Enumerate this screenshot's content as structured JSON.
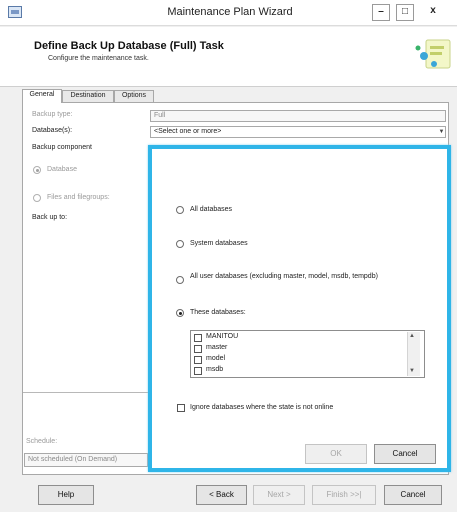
{
  "window": {
    "title": "Maintenance Plan Wizard",
    "minimize": "–",
    "maximize": "□",
    "close": "x"
  },
  "header": {
    "title": "Define Back Up Database (Full) Task",
    "subtitle": "Configure the maintenance task."
  },
  "tabs": [
    {
      "label": "General",
      "active": true
    },
    {
      "label": "Destination",
      "active": false
    },
    {
      "label": "Options",
      "active": false
    }
  ],
  "general": {
    "backup_type_label": "Backup type:",
    "backup_type_value": "Full",
    "databases_label": "Database(s):",
    "databases_placeholder": "<Select one or more>",
    "backup_component_label": "Backup component",
    "database_option": "Database",
    "files_option": "Files and filegroups:",
    "back_up_to_label": "Back up to:",
    "schedule_label": "Schedule:",
    "schedule_value": "Not scheduled (On Demand)"
  },
  "popup": {
    "all_databases": "All databases",
    "system_databases": "System databases",
    "user_databases": "All user databases  (excluding master, model, msdb, tempdb)",
    "these_databases": "These databases:",
    "database_list": [
      "MANITOU",
      "master",
      "model",
      "msdb"
    ],
    "ignore_offline": "Ignore databases where the state is not online",
    "ok": "OK",
    "cancel": "Cancel"
  },
  "footer": {
    "help": "Help",
    "back": "< Back",
    "next": "Next >",
    "finish": "Finish >>|",
    "cancel": "Cancel"
  },
  "colors": {
    "popup_border": "#2fb5e8",
    "window_bg": "#f0f0f0"
  }
}
